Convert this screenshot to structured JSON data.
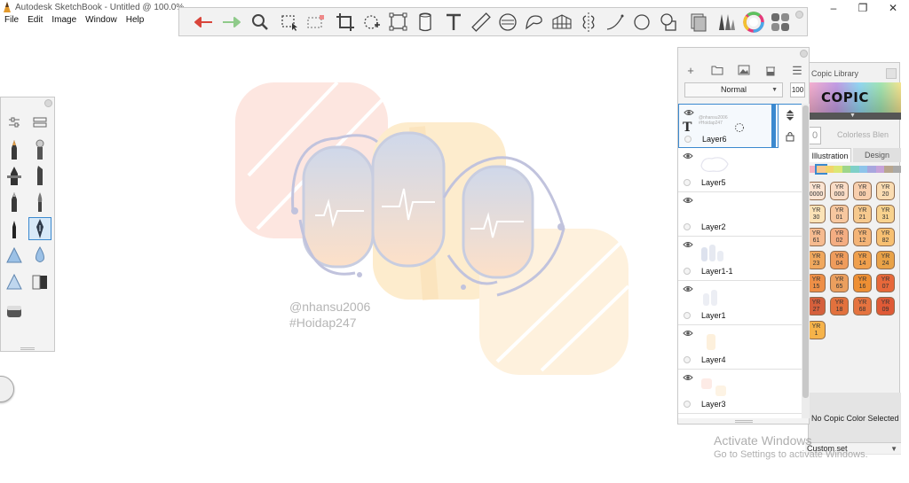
{
  "window": {
    "title": "Autodesk SketchBook - Untitled @ 100.0%",
    "minimize": "–",
    "maximize": "❐",
    "close": "✕"
  },
  "menu": [
    "File",
    "Edit",
    "Image",
    "Window",
    "Help"
  ],
  "toolbar": {
    "tools": [
      "undo-icon",
      "redo-icon",
      "zoom-icon",
      "select-icon",
      "transform-select-icon",
      "crop-icon",
      "move-icon",
      "distort-icon",
      "perspective-icon",
      "text-icon",
      "ruler-icon",
      "ellipse-guide-icon",
      "french-curve-icon",
      "perspective-grid-icon",
      "symmetry-icon",
      "line-icon",
      "circle-icon",
      "shape-icon",
      "layer-editor-icon",
      "brush-library-icon",
      "color-wheel-icon",
      "copic-library-icon"
    ]
  },
  "canvas": {
    "watermark_line1": "@nhansu2006",
    "watermark_line2": "#Hoidap247"
  },
  "layers": {
    "blend_mode": "Normal",
    "opacity": "100",
    "items": [
      {
        "name": "Layer6",
        "selected": true,
        "thumb_text": "@nhansu2006 #Hoidap247"
      },
      {
        "name": "Layer5",
        "selected": false
      },
      {
        "name": "Layer2",
        "selected": false
      },
      {
        "name": "Layer1-1",
        "selected": false
      },
      {
        "name": "Layer1",
        "selected": false
      },
      {
        "name": "Layer4",
        "selected": false
      },
      {
        "name": "Layer3",
        "selected": false
      }
    ]
  },
  "copic": {
    "title": "Copic Library",
    "logo": "COPIC",
    "blend_value": "0",
    "blend_label": "Colorless Blen",
    "tabs": [
      "Illustration",
      "Design"
    ],
    "active_tab": "Illustration",
    "swatches": [
      {
        "line1": "YR",
        "line2": "0000",
        "color": "#fbe4d2"
      },
      {
        "line1": "YR",
        "line2": "000",
        "color": "#f9dcc6"
      },
      {
        "line1": "YR",
        "line2": "00",
        "color": "#f8cfae"
      },
      {
        "line1": "YR",
        "line2": "20",
        "color": "#fadcb2"
      },
      {
        "line1": "YR",
        "line2": "30",
        "color": "#fbe3b7"
      },
      {
        "line1": "YR",
        "line2": "01",
        "color": "#f7c79f"
      },
      {
        "line1": "YR",
        "line2": "21",
        "color": "#f6c98e"
      },
      {
        "line1": "YR",
        "line2": "31",
        "color": "#f8d28e"
      },
      {
        "line1": "YR",
        "line2": "61",
        "color": "#f6bb90"
      },
      {
        "line1": "YR",
        "line2": "02",
        "color": "#f4ad82"
      },
      {
        "line1": "YR",
        "line2": "12",
        "color": "#f4b477"
      },
      {
        "line1": "YR",
        "line2": "82",
        "color": "#f7c072"
      },
      {
        "line1": "YR",
        "line2": "23",
        "color": "#f0a85e"
      },
      {
        "line1": "YR",
        "line2": "04",
        "color": "#ef9c5c"
      },
      {
        "line1": "YR",
        "line2": "14",
        "color": "#f0a04d"
      },
      {
        "line1": "YR",
        "line2": "24",
        "color": "#e9a247"
      },
      {
        "line1": "YR",
        "line2": "15",
        "color": "#ee8f47"
      },
      {
        "line1": "YR",
        "line2": "65",
        "color": "#eb9f5e"
      },
      {
        "line1": "YR",
        "line2": "16",
        "color": "#ee8f33"
      },
      {
        "line1": "YR",
        "line2": "07",
        "color": "#e7683a"
      },
      {
        "line1": "YR",
        "line2": "27",
        "color": "#d5603c"
      },
      {
        "line1": "YR",
        "line2": "18",
        "color": "#e2713d"
      },
      {
        "line1": "YR",
        "line2": "68",
        "color": "#e5733f"
      },
      {
        "line1": "YR",
        "line2": "09",
        "color": "#df5a36"
      },
      {
        "line1": "YR",
        "line2": "1",
        "color": "#f6b34a"
      }
    ],
    "no_selection": "No Copic Color Selected",
    "custom_set": "Custom set"
  },
  "os_notice": {
    "line1": "Activate Windows",
    "line2": "Go to Settings to activate Windows."
  },
  "colors": {
    "accent_blue": "#3b89cf",
    "undo_red": "#d9453b",
    "redo_green": "#8fca8a"
  }
}
